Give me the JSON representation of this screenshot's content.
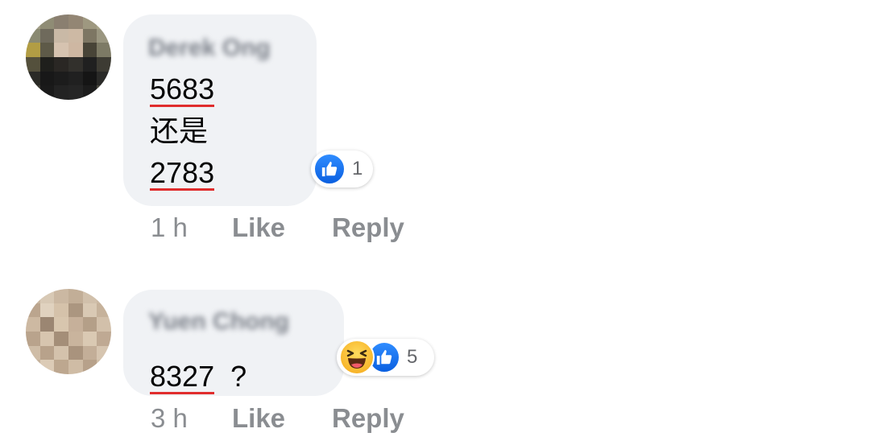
{
  "comments": [
    {
      "author": "Derek Ong",
      "text_lines": [
        "5683",
        "还是",
        "2783"
      ],
      "underlined_numbers": [
        "5683",
        "2783"
      ],
      "reactions": [
        "like"
      ],
      "reaction_count": "1",
      "timestamp": "1 h",
      "like_label": "Like",
      "reply_label": "Reply",
      "avatar_blurred": true
    },
    {
      "author": "Yuen Chong",
      "number": "8327",
      "suffix": "?",
      "reactions": [
        "haha",
        "like"
      ],
      "reaction_count": "5",
      "timestamp": "3 h",
      "like_label": "Like",
      "reply_label": "Reply",
      "avatar_blurred": true
    }
  ],
  "colors": {
    "bubble_bg": "#f0f2f5",
    "underline": "#e02d2d",
    "like_blue": "#1877f2",
    "action_gray": "#8a8d91"
  }
}
